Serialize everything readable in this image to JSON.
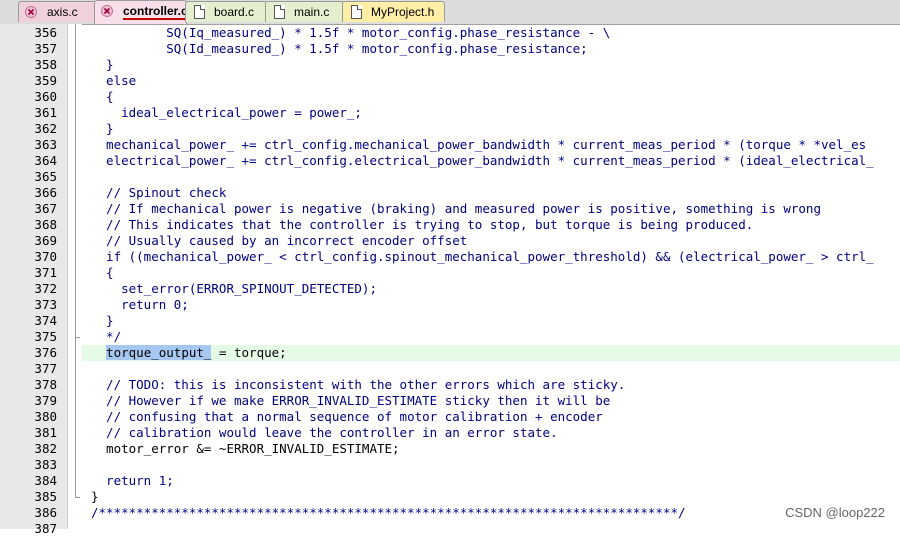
{
  "tabs": [
    {
      "label": "axis.c",
      "style": "pink",
      "icon": "close-icon"
    },
    {
      "label": "controller.c",
      "style": "active",
      "icon": "close-icon"
    },
    {
      "label": "board.c",
      "style": "green",
      "icon": "file-icon"
    },
    {
      "label": "main.c",
      "style": "green",
      "icon": "file-icon"
    },
    {
      "label": "MyProject.h",
      "style": "yellow",
      "icon": "file-icon"
    }
  ],
  "editor": {
    "lines": [
      {
        "num": "356",
        "text": "          SQ(Iq_measured_) * 1.5f * motor_config.phase_resistance - \\",
        "color": "#000080"
      },
      {
        "num": "357",
        "text": "          SQ(Id_measured_) * 1.5f * motor_config.phase_resistance;",
        "color": "#000080"
      },
      {
        "num": "358",
        "text": "  }",
        "color": "#000080"
      },
      {
        "num": "359",
        "text": "  else",
        "color": "#000080"
      },
      {
        "num": "360",
        "text": "  {",
        "color": "#000080"
      },
      {
        "num": "361",
        "text": "    ideal_electrical_power = power_;",
        "color": "#000080"
      },
      {
        "num": "362",
        "text": "  }",
        "color": "#000080"
      },
      {
        "num": "363",
        "text": "  mechanical_power_ += ctrl_config.mechanical_power_bandwidth * current_meas_period * (torque * *vel_es",
        "color": "#000080"
      },
      {
        "num": "364",
        "text": "  electrical_power_ += ctrl_config.electrical_power_bandwidth * current_meas_period * (ideal_electrical_",
        "color": "#000080"
      },
      {
        "num": "365",
        "text": "",
        "color": "#000080"
      },
      {
        "num": "366",
        "text": "  // Spinout check",
        "color": "#000080"
      },
      {
        "num": "367",
        "text": "  // If mechanical power is negative (braking) and measured power is positive, something is wrong",
        "color": "#000080"
      },
      {
        "num": "368",
        "text": "  // This indicates that the controller is trying to stop, but torque is being produced.",
        "color": "#000080"
      },
      {
        "num": "369",
        "text": "  // Usually caused by an incorrect encoder offset",
        "color": "#000080"
      },
      {
        "num": "370",
        "text": "  if ((mechanical_power_ < ctrl_config.spinout_mechanical_power_threshold) && (electrical_power_ > ctrl_",
        "color": "#000080"
      },
      {
        "num": "371",
        "text": "  {",
        "color": "#000080"
      },
      {
        "num": "372",
        "text": "    set_error(ERROR_SPINOUT_DETECTED);",
        "color": "#000080"
      },
      {
        "num": "373",
        "text": "    return 0;",
        "color": "#000080"
      },
      {
        "num": "374",
        "text": "  }",
        "color": "#000080"
      },
      {
        "num": "375",
        "text": "  */",
        "color": "#000080"
      },
      {
        "num": "376",
        "text": "  torque_output_ = torque;",
        "color": "#000000",
        "selected": "torque_output_"
      },
      {
        "num": "377",
        "text": "",
        "color": "#000080"
      },
      {
        "num": "378",
        "text": "  // TODO: this is inconsistent with the other errors which are sticky.",
        "color": "#000080"
      },
      {
        "num": "379",
        "text": "  // However if we make ERROR_INVALID_ESTIMATE sticky then it will be",
        "color": "#000080"
      },
      {
        "num": "380",
        "text": "  // confusing that a normal sequence of motor calibration + encoder",
        "color": "#000080"
      },
      {
        "num": "381",
        "text": "  // calibration would leave the controller in an error state.",
        "color": "#000080"
      },
      {
        "num": "382",
        "text": "  motor_error &= ~ERROR_INVALID_ESTIMATE;",
        "color": "#000000"
      },
      {
        "num": "383",
        "text": "",
        "color": "#000080"
      },
      {
        "num": "384",
        "text": "  return 1;",
        "color": "#000080"
      },
      {
        "num": "385",
        "text": "}",
        "color": "#000000"
      },
      {
        "num": "386",
        "text": "/*****************************************************************************/",
        "color": "#000080"
      },
      {
        "num": "387",
        "text": "",
        "color": "#000080"
      }
    ]
  },
  "watermark": "CSDN @loop222",
  "colors": {
    "current_line": "#e6fbe6",
    "selection": "#a6c8f0",
    "gutter": "#e8e8e8"
  }
}
